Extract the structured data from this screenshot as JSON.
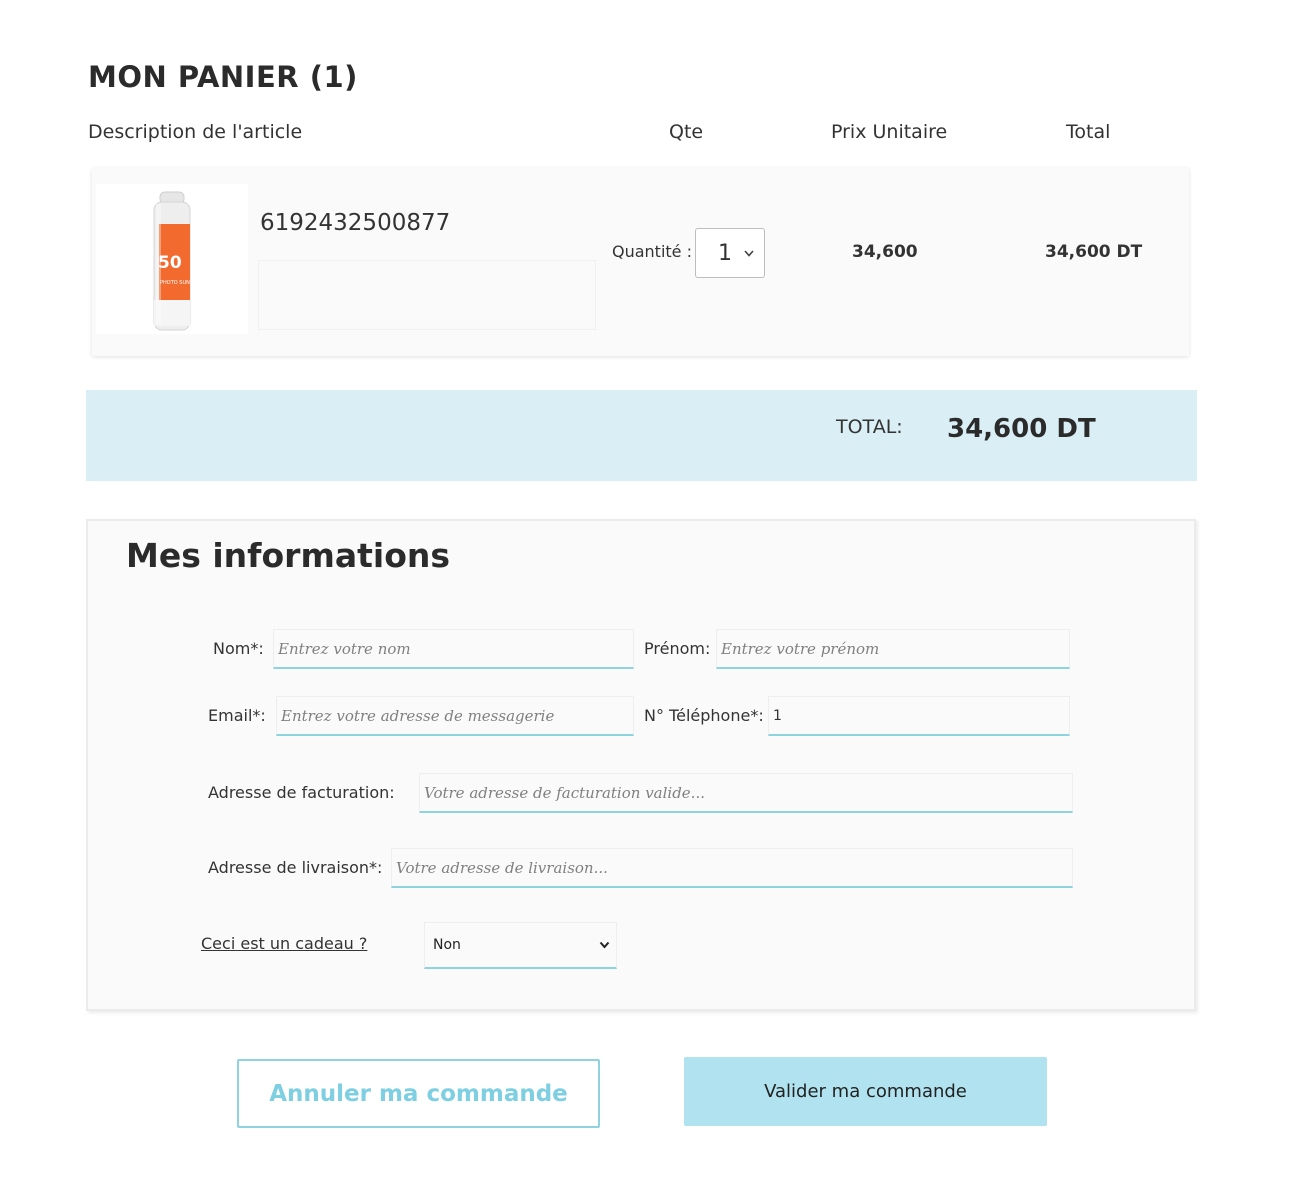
{
  "cart": {
    "title": "MON PANIER (1)",
    "columns": {
      "description": "Description de l'article",
      "qty": "Qte",
      "unit_price": "Prix Unitaire",
      "total": "Total"
    },
    "items": [
      {
        "sku": "6192432500877",
        "qty_label": "Quantité :",
        "qty_value": "1",
        "unit_price": "34,600",
        "line_total": "34,600 DT",
        "product_image_text": {
          "spf": "50",
          "brand": "PHOTO SUN"
        }
      }
    ],
    "total_label": "TOTAL:",
    "total_amount": "34,600 DT"
  },
  "info": {
    "title": "Mes informations",
    "nom": {
      "label": "Nom*:",
      "placeholder": "Entrez votre nom"
    },
    "prenom": {
      "label": "Prénom:",
      "placeholder": "Entrez votre prénom"
    },
    "email": {
      "label": "Email*:",
      "placeholder": "Entrez votre adresse de messagerie"
    },
    "telephone": {
      "label": "N° Téléphone*:",
      "value": "1"
    },
    "facturation": {
      "label": "Adresse de facturation:",
      "placeholder": "Votre adresse de facturation valide..."
    },
    "livraison": {
      "label": "Adresse de livraison*:",
      "placeholder": "Votre adresse de livraison..."
    },
    "gift": {
      "label": "Ceci est un cadeau ?",
      "selected": "Non"
    }
  },
  "actions": {
    "cancel": "Annuler ma commande",
    "validate": "Valider ma commande"
  },
  "colors": {
    "accent": "#8fd3e1",
    "total_bar": "#d9eff5",
    "validate_button": "#b0e3ef",
    "cancel_text": "#7dcfe1",
    "product_orange": "#f26a2e"
  },
  "icons": {
    "qty_dropdown": "chevron-down-icon",
    "gift_dropdown": "chevron-down-icon"
  }
}
